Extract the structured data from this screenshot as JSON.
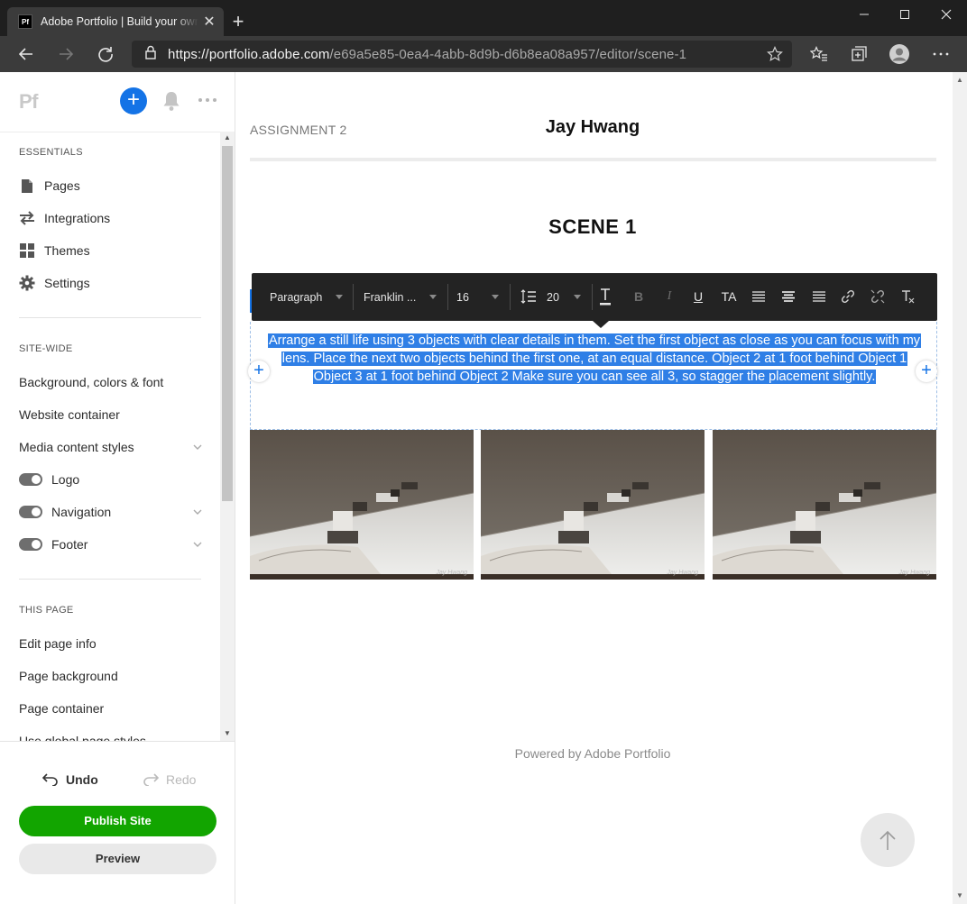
{
  "browser": {
    "tab_favicon": "Pf",
    "tab_title": "Adobe Portfolio | Build your own personalized website",
    "url_host": "https://portfolio.adobe.com",
    "url_path": "/e69a5e85-0ea4-4abb-8d9b-d6b8ea08a957/editor/scene-1"
  },
  "sidebar": {
    "logo": "Pf",
    "essentials_title": "ESSENTIALS",
    "essentials": [
      {
        "label": "Pages",
        "icon": "page-icon"
      },
      {
        "label": "Integrations",
        "icon": "arrows-icon"
      },
      {
        "label": "Themes",
        "icon": "grid-icon"
      },
      {
        "label": "Settings",
        "icon": "gear-icon"
      }
    ],
    "sitewide_title": "SITE-WIDE",
    "sitewide": [
      {
        "label": "Background, colors & font"
      },
      {
        "label": "Website container"
      },
      {
        "label": "Media content styles"
      },
      {
        "label": "Logo"
      },
      {
        "label": "Navigation"
      },
      {
        "label": "Footer"
      }
    ],
    "thispage_title": "THIS PAGE",
    "thispage": [
      {
        "label": "Edit page info"
      },
      {
        "label": "Page background"
      },
      {
        "label": "Page container"
      },
      {
        "label": "Use global page styles"
      }
    ],
    "undo": "Undo",
    "redo": "Redo",
    "publish": "Publish Site",
    "preview": "Preview"
  },
  "page": {
    "header_left": "ASSIGNMENT 2",
    "header_name": "Jay Hwang",
    "scene_title": "SCENE 1",
    "body_lines": [
      "Arrange a still life using 3 objects with clear details in them. Set the first object as close as you can focus with my",
      "lens. Place the next two objects behind the first one, at an equal distance. Object 2 at 1 foot behind Object 1",
      "Object 3 at 1 foot behind Object 2 Make sure you can see all 3, so stagger the placement slightly."
    ],
    "photo_caption": "Jay Hwang",
    "footer": "Powered by Adobe Portfolio"
  },
  "toolbar": {
    "style": "Paragraph",
    "font": "Franklin ...",
    "size": "16",
    "line_height": "20",
    "buttons": [
      "B",
      "I",
      "U",
      "TA"
    ]
  },
  "colors": {
    "accent": "#1473e6",
    "publish": "#12a500",
    "selection": "#2f7fe6"
  }
}
